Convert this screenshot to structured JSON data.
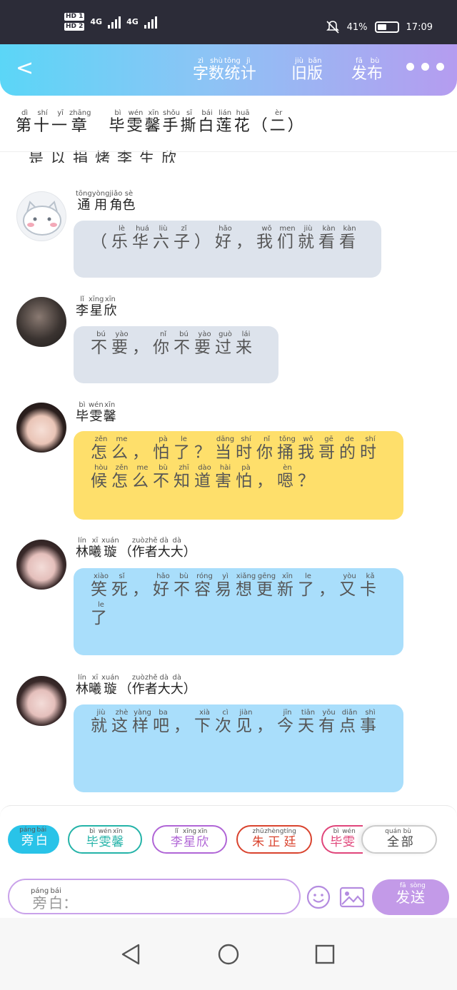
{
  "status": {
    "hd1": "HD 1",
    "hd2": "HD 2",
    "net1": "4G",
    "net2": "4G",
    "battery": "41%",
    "time": "17:09"
  },
  "header": {
    "back_label": "<",
    "stats": {
      "chars": [
        "字",
        "数",
        "统",
        "计"
      ],
      "pinyin": [
        "zì",
        "shù",
        "tǒng",
        "jì"
      ]
    },
    "oldver": {
      "chars": [
        "旧",
        "版"
      ],
      "pinyin": [
        "jiù",
        "bǎn"
      ]
    },
    "publish": {
      "chars": [
        "发",
        "布"
      ],
      "pinyin": [
        "fā",
        "bù"
      ]
    }
  },
  "chapter": {
    "chars": [
      "第",
      "十",
      "一",
      "章",
      "　",
      "毕",
      "雯",
      "馨",
      "手",
      "撕",
      "白",
      "莲",
      "花",
      "（",
      "二",
      "）"
    ],
    "pinyin": [
      "dì",
      "shí",
      "yī",
      "zhāng",
      "",
      "bì",
      "wén",
      "xīn",
      "shǒu",
      "sī",
      "bái",
      "lián",
      "huā",
      "",
      "èr",
      ""
    ]
  },
  "cut_text": "是以捐烤李生欣",
  "messages": [
    {
      "name": {
        "chars": [
          "通",
          "用",
          "角",
          "色"
        ],
        "pinyin": [
          "tōng",
          "yòng",
          "jiǎo",
          "sè"
        ]
      },
      "text": {
        "chars": [
          "（",
          "乐",
          "华",
          "六",
          "子",
          "）",
          "好",
          "，",
          "我",
          "们",
          "就",
          "看",
          "看"
        ],
        "pinyin": [
          "",
          "lè",
          "huá",
          "liù",
          "zǐ",
          "",
          "hǎo",
          "",
          "wǒ",
          "men",
          "jiù",
          "kàn",
          "kàn"
        ]
      }
    },
    {
      "name": {
        "chars": [
          "李",
          "星",
          "欣"
        ],
        "pinyin": [
          "lǐ",
          "xīng",
          "xīn"
        ]
      },
      "text": {
        "chars": [
          "不",
          "要",
          "，",
          "你",
          "不",
          "要",
          "过",
          "来"
        ],
        "pinyin": [
          "bú",
          "yào",
          "",
          "nǐ",
          "bú",
          "yào",
          "guò",
          "lái"
        ]
      }
    },
    {
      "name": {
        "chars": [
          "毕",
          "雯",
          "馨"
        ],
        "pinyin": [
          "bì",
          "wén",
          "xīn"
        ]
      },
      "text": {
        "chars": [
          "怎",
          "么",
          "，",
          "怕",
          "了",
          "？",
          "当",
          "时",
          "你",
          "捅",
          "我",
          "哥",
          "的",
          "时",
          "候",
          "怎",
          "么",
          "不",
          "知",
          "道",
          "害",
          "怕",
          "，",
          "嗯",
          "？"
        ],
        "pinyin": [
          "zěn",
          "me",
          "",
          "pà",
          "le",
          "",
          "dāng",
          "shí",
          "nǐ",
          "tǒng",
          "wǒ",
          "gē",
          "de",
          "shí",
          "hòu",
          "zěn",
          "me",
          "bù",
          "zhī",
          "dào",
          "hài",
          "pà",
          "",
          "èn",
          ""
        ]
      }
    },
    {
      "name": {
        "chars": [
          "林",
          "曦",
          "璇",
          "（",
          "作",
          "者",
          "大",
          "大",
          "）"
        ],
        "pinyin": [
          "lín",
          "xī",
          "xuán",
          "",
          "zuò",
          "zhě",
          "dà",
          "dà",
          ""
        ]
      },
      "text": {
        "chars": [
          "笑",
          "死",
          "，",
          "好",
          "不",
          "容",
          "易",
          "想",
          "更",
          "新",
          "了",
          "，",
          "又",
          "卡",
          "了"
        ],
        "pinyin": [
          "xiào",
          "sǐ",
          "",
          "hǎo",
          "bù",
          "róng",
          "yì",
          "xiǎng",
          "gēng",
          "xīn",
          "le",
          "",
          "yòu",
          "kǎ",
          "le"
        ]
      }
    },
    {
      "name": {
        "chars": [
          "林",
          "曦",
          "璇",
          "（",
          "作",
          "者",
          "大",
          "大",
          "）"
        ],
        "pinyin": [
          "lín",
          "xī",
          "xuán",
          "",
          "zuò",
          "zhě",
          "dà",
          "dà",
          ""
        ]
      },
      "text": {
        "chars": [
          "就",
          "这",
          "样",
          "吧",
          "，",
          "下",
          "次",
          "见",
          "，",
          "今",
          "天",
          "有",
          "点",
          "事"
        ],
        "pinyin": [
          "jiù",
          "zhè",
          "yàng",
          "ba",
          "",
          "xià",
          "cì",
          "jiàn",
          "",
          "jīn",
          "tiān",
          "yǒu",
          "diǎn",
          "shì"
        ]
      }
    }
  ],
  "chips": [
    {
      "chars": [
        "旁",
        "白"
      ],
      "pinyin": [
        "páng",
        "bái"
      ],
      "color": "#29c3e8",
      "filled": true
    },
    {
      "chars": [
        "毕",
        "雯",
        "馨"
      ],
      "pinyin": [
        "bì",
        "wén",
        "xīn"
      ],
      "color": "#24b3a8",
      "filled": false
    },
    {
      "chars": [
        "李",
        "星",
        "欣"
      ],
      "pinyin": [
        "lǐ",
        "xīng",
        "xīn"
      ],
      "color": "#b065d6",
      "filled": false
    },
    {
      "chars": [
        "朱",
        "正",
        "廷"
      ],
      "pinyin": [
        "zhū",
        "zhèng",
        "tíng"
      ],
      "color": "#d9432e",
      "filled": false
    },
    {
      "chars": [
        "毕",
        "雯"
      ],
      "pinyin": [
        "bì",
        "wén"
      ],
      "color": "#e0457a",
      "filled": false
    },
    {
      "chars": [
        "全",
        "部"
      ],
      "pinyin": [
        "quán",
        "bù"
      ],
      "color": "#bbbbbb",
      "filled": false
    }
  ],
  "composer": {
    "placeholder": {
      "chars": [
        "旁",
        "白",
        "："
      ],
      "pinyin": [
        "páng",
        "bái",
        ""
      ]
    }
  },
  "send": {
    "chars": [
      "发",
      "送"
    ],
    "pinyin": [
      "fā",
      "sòng"
    ]
  },
  "colors": {
    "accent": "#c39ae8",
    "header_start": "#5bd6f7",
    "header_end": "#b59cf0"
  }
}
